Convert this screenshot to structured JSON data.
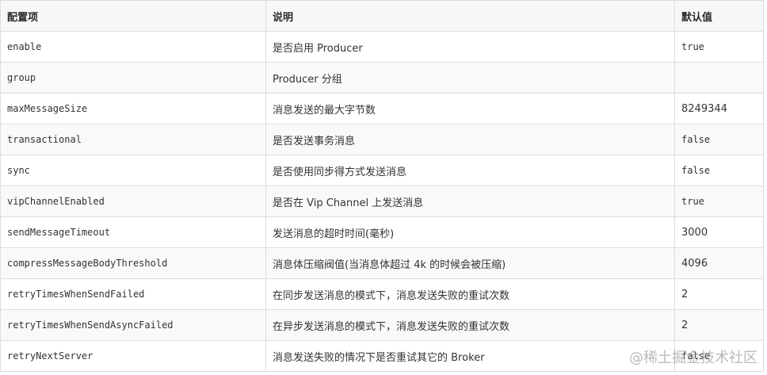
{
  "table": {
    "headers": [
      "配置项",
      "说明",
      "默认值"
    ],
    "rows": [
      {
        "key": "enable",
        "desc": "是否启用 Producer",
        "default": "true"
      },
      {
        "key": "group",
        "desc": "Producer 分组",
        "default": ""
      },
      {
        "key": "maxMessageSize",
        "desc": "消息发送的最大字节数",
        "default": "8249344"
      },
      {
        "key": "transactional",
        "desc": "是否发送事务消息",
        "default": "false"
      },
      {
        "key": "sync",
        "desc": "是否使用同步得方式发送消息",
        "default": "false"
      },
      {
        "key": "vipChannelEnabled",
        "desc": "是否在 Vip Channel 上发送消息",
        "default": "true"
      },
      {
        "key": "sendMessageTimeout",
        "desc": "发送消息的超时时间(毫秒)",
        "default": "3000"
      },
      {
        "key": "compressMessageBodyThreshold",
        "desc": "消息体压缩阀值(当消息体超过 4k 的时候会被压缩)",
        "default": "4096"
      },
      {
        "key": "retryTimesWhenSendFailed",
        "desc": "在同步发送消息的模式下，消息发送失败的重试次数",
        "default": "2"
      },
      {
        "key": "retryTimesWhenSendAsyncFailed",
        "desc": "在异步发送消息的模式下，消息发送失败的重试次数",
        "default": "2"
      },
      {
        "key": "retryNextServer",
        "desc": "消息发送失败的情况下是否重试其它的 Broker",
        "default": "false"
      }
    ]
  },
  "watermark": "@稀土掘金技术社区"
}
